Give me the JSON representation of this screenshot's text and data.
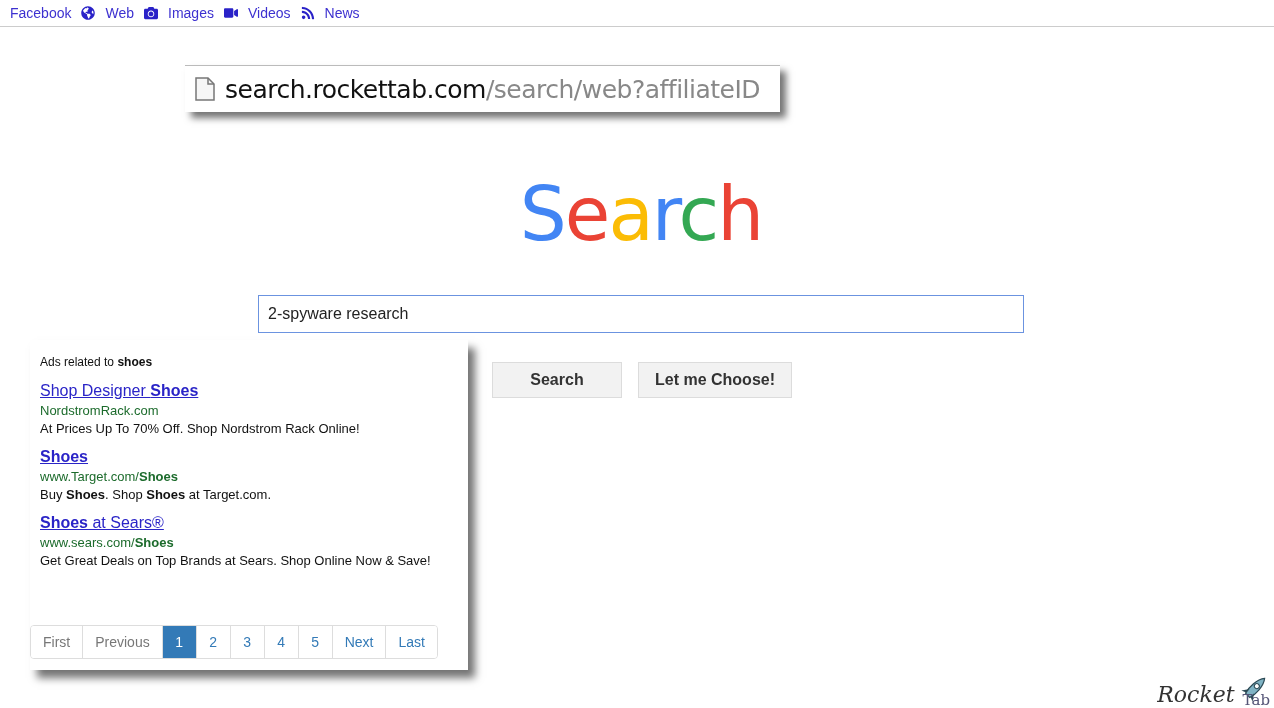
{
  "nav": [
    {
      "label": "Facebook",
      "kind": "plain"
    },
    {
      "label": "Web",
      "kind": "globe"
    },
    {
      "label": "Images",
      "kind": "camera"
    },
    {
      "label": "Videos",
      "kind": "video"
    },
    {
      "label": "News",
      "kind": "rss"
    }
  ],
  "address_bar": {
    "host": "search.rockettab.com",
    "path": "/search/web?affiliateID"
  },
  "logo": "Search",
  "search": {
    "value": "2-spyware research"
  },
  "buttons": [
    "Search",
    "Let me Choose!"
  ],
  "ads": {
    "heading": "Ads related to **shoes**",
    "items": [
      {
        "title": "Shop Designer **Shoes**",
        "url": "NordstromRack.com",
        "description": "At Prices Up To 70% Off. Shop Nordstrom Rack Online!"
      },
      {
        "title": "**Shoes**",
        "url": "www.Target.com/**Shoes**",
        "description": "Buy **Shoes**. Shop **Shoes** at Target.com."
      },
      {
        "title": "**Shoes** at Sears®",
        "url": "www.sears.com/**Shoes**",
        "description": "Get Great Deals on Top Brands at Sears. Shop Online Now & Save!"
      }
    ],
    "pagination": [
      {
        "label": "First",
        "selected": false,
        "disabled": true
      },
      {
        "label": "Previous",
        "selected": false,
        "disabled": true
      },
      {
        "label": "1",
        "selected": true,
        "disabled": false
      },
      {
        "label": "2",
        "selected": false,
        "disabled": false
      },
      {
        "label": "3",
        "selected": false,
        "disabled": false
      },
      {
        "label": "4",
        "selected": false,
        "disabled": false
      },
      {
        "label": "5",
        "selected": false,
        "disabled": false
      },
      {
        "label": "Next",
        "selected": false,
        "disabled": false
      },
      {
        "label": "Last",
        "selected": false,
        "disabled": false
      }
    ]
  },
  "brand": {
    "name": "Rocket",
    "sub": "Tab"
  }
}
